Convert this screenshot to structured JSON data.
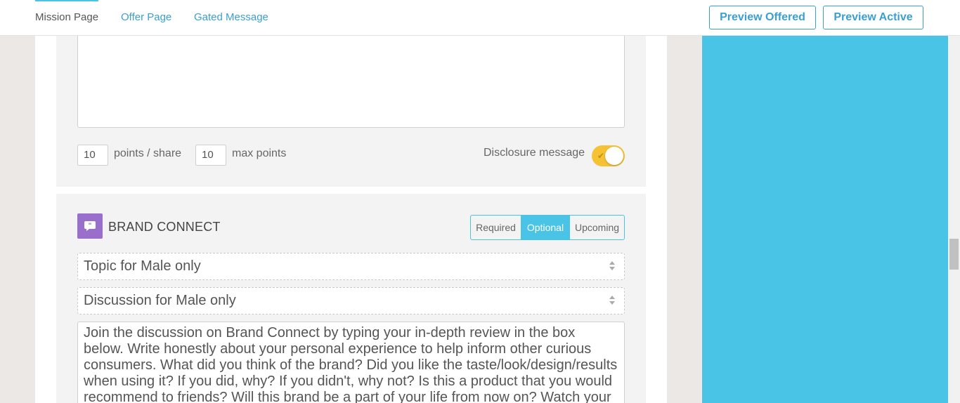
{
  "tabs": {
    "mission": "Mission Page",
    "offer": "Offer Page",
    "gated": "Gated Message"
  },
  "header_buttons": {
    "preview_offered": "Preview Offered",
    "preview_active": "Preview Active"
  },
  "share_settings": {
    "points_per_share_value": "10",
    "points_per_share_label": "points / share",
    "max_points_value": "10",
    "max_points_label": "max points",
    "disclosure_label": "Disclosure message",
    "disclosure_enabled": true
  },
  "brand_connect": {
    "title": "BRAND CONNECT",
    "icon": "speech-bubble-quote-icon",
    "icon_color": "#9a6fcb",
    "status_options": [
      "Required",
      "Optional",
      "Upcoming"
    ],
    "status_selected": "Optional",
    "topic_select": "Topic for Male only",
    "discussion_select": "Discussion for Male only",
    "description": "Join the discussion on Brand Connect by typing your in-depth review in the box below. Write honestly about your personal experience to help inform other curious consumers. What did you think of the brand? Did you like the taste/look/design/results when using it? If you did, why? If you didn't, why not? Is this a product that you would recommend to friends? Will this brand be a part of your life from now on? Watch your"
  },
  "colors": {
    "accent": "#4ac4e6",
    "link": "#3aa0cf",
    "toggle_on": "#f5c233"
  }
}
